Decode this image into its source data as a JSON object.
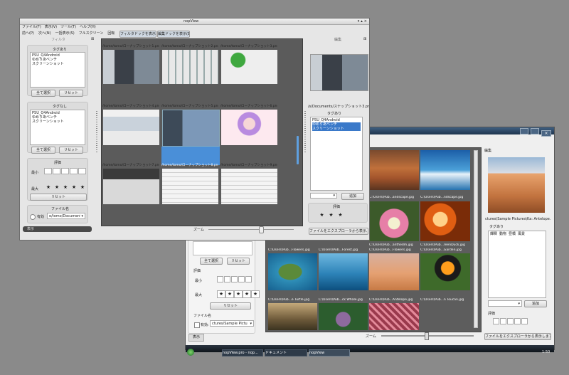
{
  "win2": {
    "panel_header": "編集",
    "path_caption": "ctures\\Sample Pictures\\Ka: Antelope.jpg",
    "tag_header": "タグあり",
    "tags": [
      "輝瞬",
      "動物",
      "昼橋",
      "風景"
    ],
    "tag_button": "追加",
    "rating_label": "評価",
    "open_button": "ファイルをエクスプローラから表示します。",
    "left": {
      "select_all": "全て選択",
      "reset": "リセット",
      "rating_label": "評価",
      "min_label": "最小",
      "max_label": "最大",
      "stars": [
        "★",
        "★",
        "★",
        "★",
        "★"
      ],
      "reset2": "リセット",
      "filename_label": "ファイル名",
      "enable_label": "有効:",
      "path_value": "ctures/Sample Pictures",
      "bottom_tab": "表示"
    },
    "thumbs": [
      {
        "caption": "C:\\Users\\Pub...andscape.jpg"
      },
      {
        "caption": "C:\\Users\\Pub...ndscape.jpg"
      },
      {
        "caption": "C:\\Users\\Pub...anthedm.jpg"
      },
      {
        "caption": "C:\\Users\\Pub...reenDuck.jpg"
      },
      {
        "caption": "C:\\Users\\Pub...Flowers.jpg"
      },
      {
        "caption": "C:\\Users\\Pub...Forest.jpg"
      },
      {
        "caption": "C:\\Users\\Pub...Flowers.jpg"
      },
      {
        "caption": "C:\\Users\\Pub...Garden.jpg"
      },
      {
        "caption": "C:\\Users\\Pub...e Turtle.jpg"
      },
      {
        "caption": "C:\\Users\\Pub...ck Whale.jpg"
      },
      {
        "caption": "C:\\Users\\Pub...Antelope.jpg"
      },
      {
        "caption": "C:\\Users\\Pub...n Toucan.jpg"
      }
    ],
    "zoom_label": "ズーム",
    "taskbar": {
      "items": [
        "nopView.pro - nop...",
        "ドキュメント",
        "nopView"
      ],
      "clock": "1:50"
    }
  },
  "win1": {
    "title": "nopView",
    "menu": [
      "ファイル(F)",
      "表示(V)",
      "ツール(T)",
      "ヘルプ(H)"
    ],
    "toolbar": [
      "前へ(P)",
      "次へ(N)",
      "一括表示(S)",
      "フルスクリーン",
      "回転"
    ],
    "toggle_buttons": [
      "フィルタドックを表示(F)",
      "編集ドックを表示(E)"
    ],
    "filter_dock": {
      "header": "フィルタ",
      "tagged_header": "タグあり",
      "tagged_items": [
        "PSU_Q4Android",
        "ゆめりあベンチ",
        "スクリーンショット"
      ],
      "select_all": "全て選択",
      "reset": "リセット",
      "untagged_header": "タグなし",
      "untagged_items": [
        "PSU_Q4Android",
        "ゆめりあベンチ",
        "スクリーンショット"
      ],
      "select_all2": "全て選択",
      "reset2": "リセット",
      "rating_header": "評価",
      "min_label": "最小",
      "max_label": "最大",
      "stars": [
        "★",
        "★",
        "★",
        "★",
        "★"
      ],
      "reset3": "リセット",
      "filename_header": "ファイル名",
      "enable_label": "有効",
      "path_value": "e/tomo/Documents",
      "bottom_tab": "表示"
    },
    "thumbs": [
      {
        "caption": "/home/tomo/ローナップショット1.png"
      },
      {
        "caption": "/home/tomo/ローナップショット2.png"
      },
      {
        "caption": "/home/tomo/ローナップショット3.png"
      },
      {
        "caption": "/home/tomo/ローナップショット4.png"
      },
      {
        "caption": "/home/tomo/ローナップショット5.png"
      },
      {
        "caption": "/home/tomo/ローナップショット6.png"
      },
      {
        "caption": "/home/tomo/ローナップショット7.png"
      },
      {
        "caption": "/home/tomo/ローナップショット8.png"
      },
      {
        "caption": "/home/tomo/ローナップショット9.png"
      }
    ],
    "zoom_label": "ズーム",
    "edit_dock": {
      "header": "編集",
      "path_caption": "/s/Documents/スナップショット3.png",
      "tag_header": "タグあり",
      "tags": [
        "PSU_Q4Android",
        "ゆめりあベンチ",
        "スクリーンショット"
      ],
      "tag_button": "追加",
      "rating_header": "評価",
      "stars": [
        "★",
        "★",
        "★"
      ],
      "open_button": "ファイルをエクスプローラから表示..."
    }
  }
}
